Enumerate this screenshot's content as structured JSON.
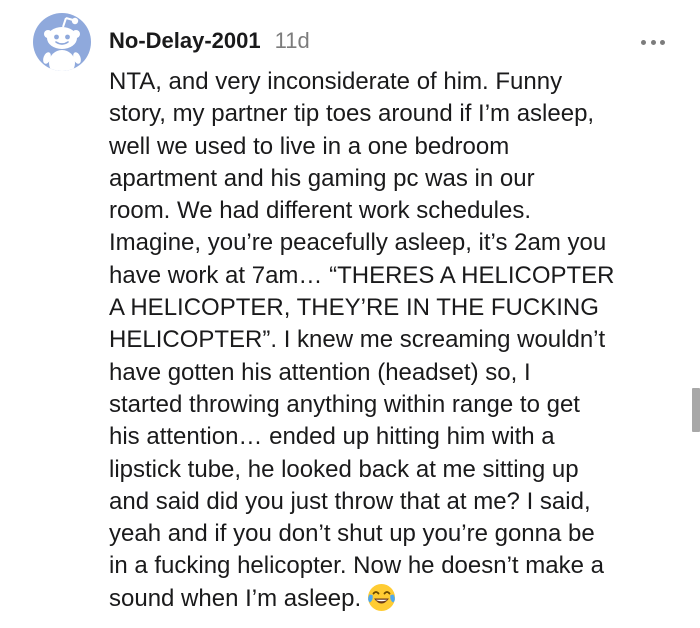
{
  "comment": {
    "username": "No-Delay-2001",
    "timestamp": "11d",
    "body_lines": [
      "NTA, and very inconsiderate of him. Funny",
      "story, my partner tip toes around if I’m asleep,",
      "well we used to live in a one bedroom",
      "apartment and his gaming pc was in our",
      "room. We had different work schedules.",
      "Imagine, you’re peacefully asleep, it’s 2am you",
      "have work at 7am… “THERES A HELICOPTER",
      "A HELICOPTER, THEY’RE IN THE FUCKING",
      "HELICOPTER”. I knew me screaming wouldn’t",
      "have gotten his attention (headset) so, I",
      "started throwing anything within range to get",
      "his attention… ended up hitting him with a",
      "lipstick tube, he looked back at me sitting up",
      "and said did you just throw that at me? I said,",
      "yeah and if you don’t shut up you’re gonna be",
      "in a fucking helicopter. Now he doesn’t make a",
      "sound when I’m asleep."
    ],
    "emoji": "face-with-tears-of-joy-icon",
    "avatar_icon": "snoo-avatar-icon",
    "more_icon": "more-options-icon"
  },
  "colors": {
    "avatar_background": "#8fa9dc",
    "text_primary": "#1a1a1b",
    "text_secondary": "#7c7c7c",
    "emoji_face": "#ffcc33",
    "emoji_tears": "#4fa8f0",
    "scrollbar": "#a8a8a8"
  }
}
